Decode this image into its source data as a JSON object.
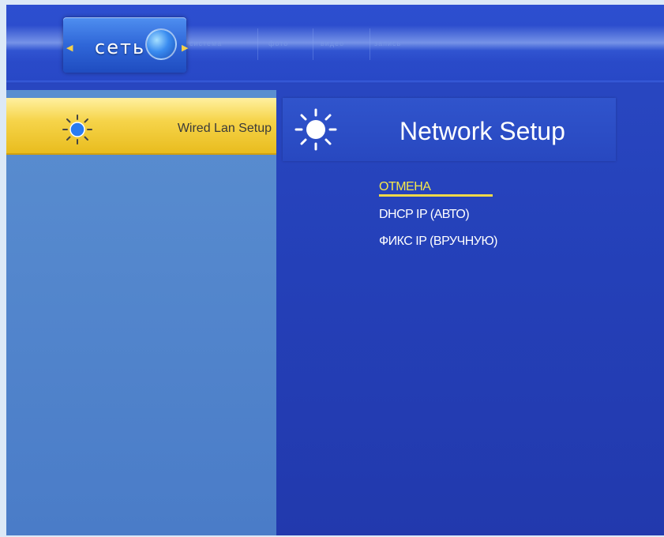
{
  "header": {
    "active_tab_label": "сеть",
    "inactive_tabs": [
      "система",
      "фото",
      "видео",
      "запись"
    ]
  },
  "sidebar": {
    "items": [
      {
        "label": "Wired Lan Setup",
        "icon": "sun-icon",
        "selected": true
      }
    ]
  },
  "main": {
    "title": "Network Setup",
    "title_icon": "sun-icon",
    "options": [
      {
        "label": "ОТМЕНА",
        "selected": true
      },
      {
        "label": "DHCP IP (АВТО)",
        "selected": false
      },
      {
        "label": "ФИКС IP (ВРУЧНУЮ)",
        "selected": false
      }
    ]
  },
  "colors": {
    "background": "#2440b8",
    "sidebar": "#4a7cc8",
    "highlight": "#f6d44a",
    "selected_text": "#f6e84a"
  }
}
